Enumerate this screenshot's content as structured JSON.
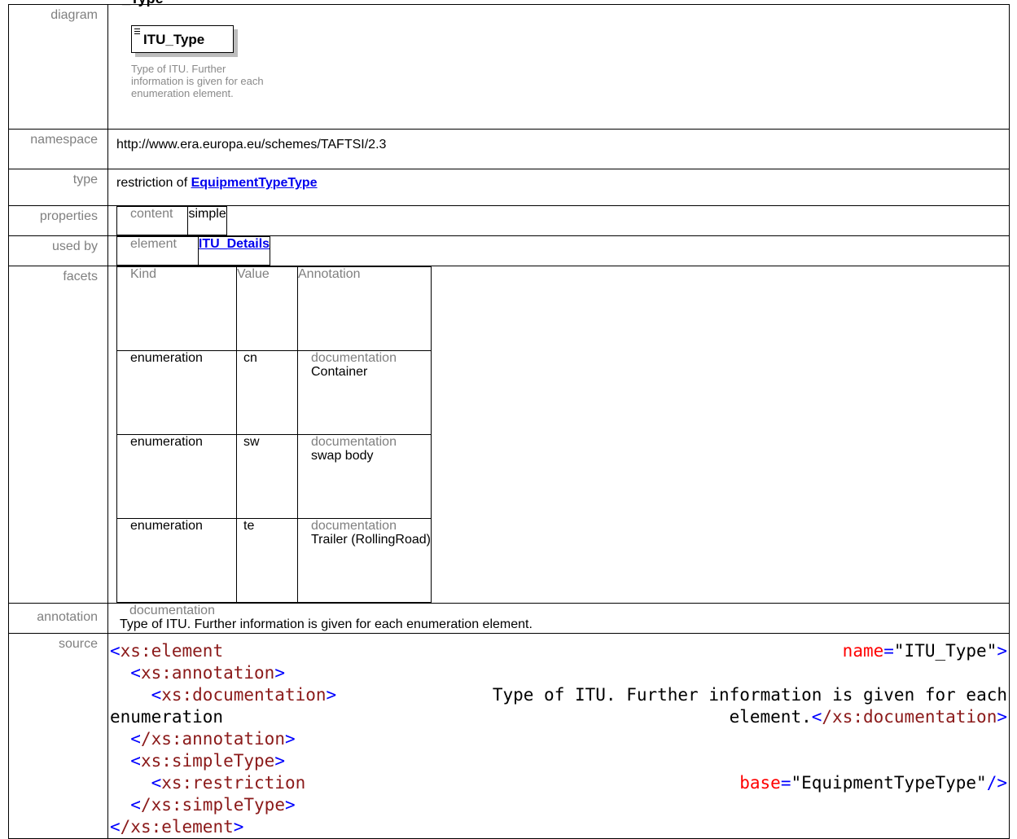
{
  "heading": "_Type",
  "labels": {
    "diagram": "diagram",
    "namespace": "namespace",
    "type": "type",
    "properties": "properties",
    "used_by": "used by",
    "facets": "facets",
    "annotation": "annotation",
    "source": "source"
  },
  "diagram": {
    "element_name": "ITU_Type",
    "description": "Type of ITU. Further information is given for each enumeration element."
  },
  "namespace": "http://www.era.europa.eu/schemes/TAFTSI/2.3",
  "type": {
    "prefix": "restriction of",
    "link": "EquipmentTypeType"
  },
  "properties": {
    "key": "content",
    "value": "simple"
  },
  "used_by": {
    "kind": "element",
    "link": "ITU_Details"
  },
  "facets": {
    "headers": [
      "Kind",
      "Value",
      "Annotation"
    ],
    "rows": [
      {
        "kind": "enumeration",
        "value": "cn",
        "ann_label": "documentation",
        "ann_text": "Container"
      },
      {
        "kind": "enumeration",
        "value": "sw",
        "ann_label": "documentation",
        "ann_text": "swap body"
      },
      {
        "kind": "enumeration",
        "value": "te",
        "ann_label": "documentation",
        "ann_text": "Trailer (RollingRoad)"
      }
    ]
  },
  "annotation": {
    "label": "documentation",
    "text": "Type of ITU. Further information is given for each enumeration element."
  },
  "source": {
    "l1_tag": "xs:element",
    "l1_attr": "name",
    "l1_val": "\"ITU_Type\"",
    "l2_tag": "xs:annotation",
    "l3_tag": "xs:documentation",
    "l3_text": "Type of ITU. Further information is given for each",
    "l4_text_a": "enumeration",
    "l4_text_b": "element.",
    "l4_close": "/xs:documentation",
    "l5_close": "/xs:annotation",
    "l6_tag": "xs:simpleType",
    "l7_tag": "xs:restriction",
    "l7_attr": "base",
    "l7_val": "\"EquipmentTypeType\"",
    "l8_close": "/xs:simpleType",
    "l9_close": "/xs:element"
  },
  "colors": {
    "link": "#0000ee",
    "label": "#808080",
    "xml_tag": "#8b1a1a",
    "xml_bracket": "#0000ff",
    "xml_attr": "#ff0000"
  },
  "icons": {
    "element_lines": "element-lines-icon"
  }
}
